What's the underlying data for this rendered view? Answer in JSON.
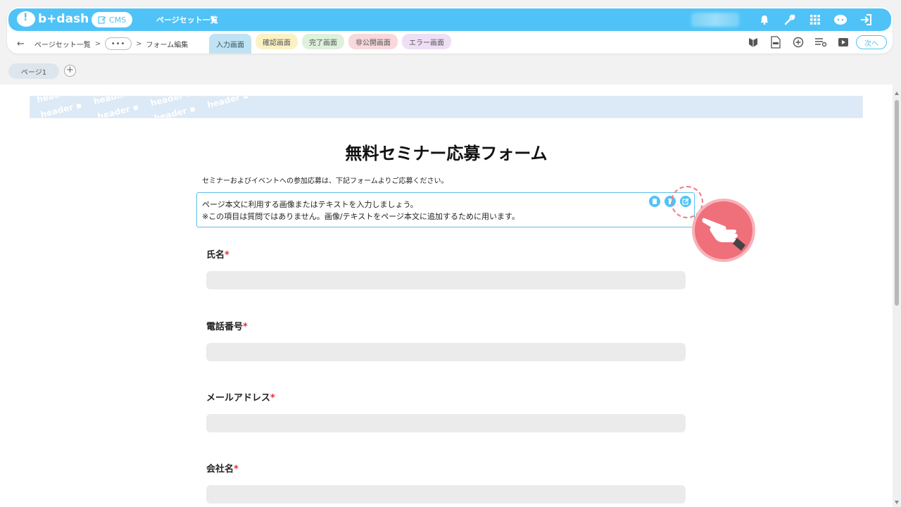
{
  "header": {
    "logo_text": "b+dash",
    "cms_label": "CMS",
    "title": "ページセット一覧",
    "icons": [
      "bell-icon",
      "wrench-icon",
      "grid-icon",
      "support-icon",
      "logout-icon"
    ]
  },
  "breadcrumb": {
    "back": "←",
    "item1": "ページセット一覧",
    "sep1": ">",
    "more": "•••",
    "sep2": ">",
    "item2": "フォーム編集"
  },
  "tabs": [
    {
      "label": "入力画面"
    },
    {
      "label": "確認画面"
    },
    {
      "label": "完了画面"
    },
    {
      "label": "非公開画面"
    },
    {
      "label": "エラー画面"
    }
  ],
  "toolbar": {
    "icons": [
      "beginner-mark-icon",
      "html-file-icon",
      "add-circle-icon",
      "list-settings-icon",
      "video-icon"
    ],
    "next_label": "次へ"
  },
  "pages": {
    "tab1": "ページ1",
    "add": "+"
  },
  "canvas": {
    "header_word": "header",
    "title": "無料セミナー応募フォーム",
    "description": "セミナーおよびイベントへの参加応募は、下記フォームよりご応募ください。",
    "content_line1": "ページ本文に利用する画像またはテキストを入力しましょう。",
    "content_line2": "※この項目は質問ではありません。画像/テキストをページ本文に追加するために用います。",
    "box_icons": [
      "copy-icon",
      "delete-icon",
      "edit-icon"
    ]
  },
  "fields": [
    {
      "label": "氏名",
      "required": "*"
    },
    {
      "label": "電話番号",
      "required": "*"
    },
    {
      "label": "メールアドレス",
      "required": "*"
    },
    {
      "label": "会社名",
      "required": "*"
    }
  ],
  "colors": {
    "brand": "#4fc3f7",
    "highlight": "#ef6f7b",
    "required": "#e0333b"
  }
}
